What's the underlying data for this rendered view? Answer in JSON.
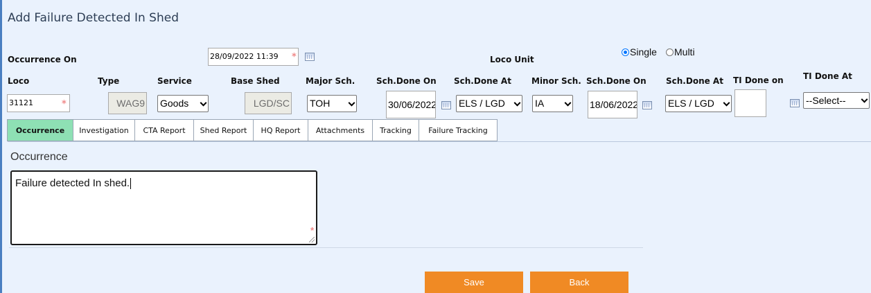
{
  "title": "Add Failure Detected In Shed",
  "occurrence_on": {
    "label": "Occurrence On",
    "value": "28/09/2022 11:39"
  },
  "loco_unit": {
    "label": "Loco Unit",
    "options": [
      "Single",
      "Multi"
    ],
    "selected": "Single"
  },
  "fields": {
    "loco": {
      "label": "Loco",
      "value": "31121"
    },
    "type": {
      "label": "Type",
      "value": "WAG9"
    },
    "service": {
      "label": "Service",
      "value": "Goods"
    },
    "base_shed": {
      "label": "Base Shed",
      "value": "LGD/SC"
    },
    "major_sch": {
      "label": "Major Sch.",
      "value": "TOH"
    },
    "sch_done_on_1": {
      "label": "Sch.Done On",
      "value": "30/06/2022"
    },
    "sch_done_at_1": {
      "label": "Sch.Done At",
      "value": "ELS / LGD"
    },
    "minor_sch": {
      "label": "Minor Sch.",
      "value": "IA"
    },
    "sch_done_on_2": {
      "label": "Sch.Done On",
      "value": "18/06/2022"
    },
    "sch_done_at_2": {
      "label": "Sch.Done At",
      "value": "ELS / LGD"
    },
    "ti_done_on": {
      "label": "TI Done on",
      "value": ""
    },
    "ti_done_at": {
      "label": "TI Done At",
      "value": "--Select--"
    }
  },
  "tabs": [
    {
      "label": "Occurrence",
      "active": true
    },
    {
      "label": "Investigation"
    },
    {
      "label": "CTA Report"
    },
    {
      "label": "Shed Report"
    },
    {
      "label": "HQ Report"
    },
    {
      "label": "Attachments"
    },
    {
      "label": "Tracking"
    },
    {
      "label": "Failure Tracking"
    }
  ],
  "occurrence_section": {
    "label": "Occurrence",
    "text": "Failure detected In shed."
  },
  "buttons": {
    "save": "Save",
    "back": "Back"
  },
  "required_marker": "*",
  "colors": {
    "accent_orange": "#f08a24",
    "active_tab": "#8ee0b4",
    "frame_border": "#4a7fc1",
    "background": "#eaf2fd"
  }
}
